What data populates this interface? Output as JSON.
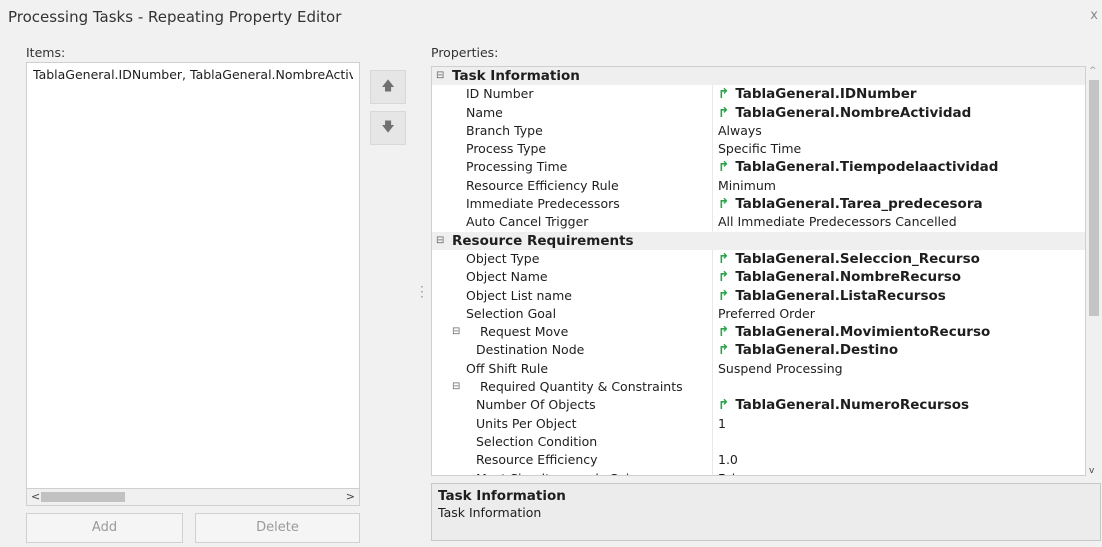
{
  "window": {
    "title": "Processing Tasks - Repeating Property Editor",
    "close_glyph": "x"
  },
  "items": {
    "label": "Items:",
    "entries": [
      "TablaGeneral.IDNumber, TablaGeneral.NombreActiv"
    ],
    "add_label": "Add",
    "delete_label": "Delete"
  },
  "move": {
    "up_icon": "arrow-up-icon",
    "down_icon": "arrow-down-icon"
  },
  "properties": {
    "label": "Properties:",
    "rows": [
      {
        "type": "category",
        "name": "Task Information"
      },
      {
        "name": "ID Number",
        "value": "TablaGeneral.IDNumber",
        "ref": true
      },
      {
        "name": "Name",
        "value": "TablaGeneral.NombreActividad",
        "ref": true
      },
      {
        "name": "Branch Type",
        "value": "Always"
      },
      {
        "name": "Process Type",
        "value": "Specific Time"
      },
      {
        "name": "Processing Time",
        "value": "TablaGeneral.Tiempodelaactividad",
        "ref": true
      },
      {
        "name": "Resource Efficiency Rule",
        "value": "Minimum"
      },
      {
        "name": "Immediate Predecessors",
        "value": "TablaGeneral.Tarea_predecesora",
        "ref": true
      },
      {
        "name": "Auto Cancel Trigger",
        "value": "All Immediate Predecessors Cancelled"
      },
      {
        "type": "category",
        "name": "Resource Requirements"
      },
      {
        "name": "Object Type",
        "value": "TablaGeneral.Seleccion_Recurso",
        "ref": true
      },
      {
        "name": "Object Name",
        "value": "TablaGeneral.NombreRecurso",
        "ref": true
      },
      {
        "name": "Object List name",
        "value": "TablaGeneral.ListaRecursos",
        "ref": true
      },
      {
        "name": "Selection Goal",
        "value": "Preferred Order"
      },
      {
        "name": "Request Move",
        "value": "TablaGeneral.MovimientoRecurso",
        "ref": true,
        "group": true
      },
      {
        "name": "Destination Node",
        "value": "TablaGeneral.Destino",
        "ref": true,
        "level": 2
      },
      {
        "name": "Off Shift Rule",
        "value": "Suspend Processing"
      },
      {
        "name": "Required Quantity & Constraints",
        "value": "",
        "group": true
      },
      {
        "name": "Number Of Objects",
        "value": "TablaGeneral.NumeroRecursos",
        "ref": true,
        "level": 2
      },
      {
        "name": "Units Per Object",
        "value": "1",
        "level": 2
      },
      {
        "name": "Selection Condition",
        "value": "",
        "level": 2
      },
      {
        "name": "Resource Efficiency",
        "value": "1.0",
        "level": 2
      },
      {
        "name": "Must Simultaneously Seize",
        "value": "False",
        "level": 2
      }
    ]
  },
  "description": {
    "title": "Task Information",
    "text": "Task Information"
  }
}
